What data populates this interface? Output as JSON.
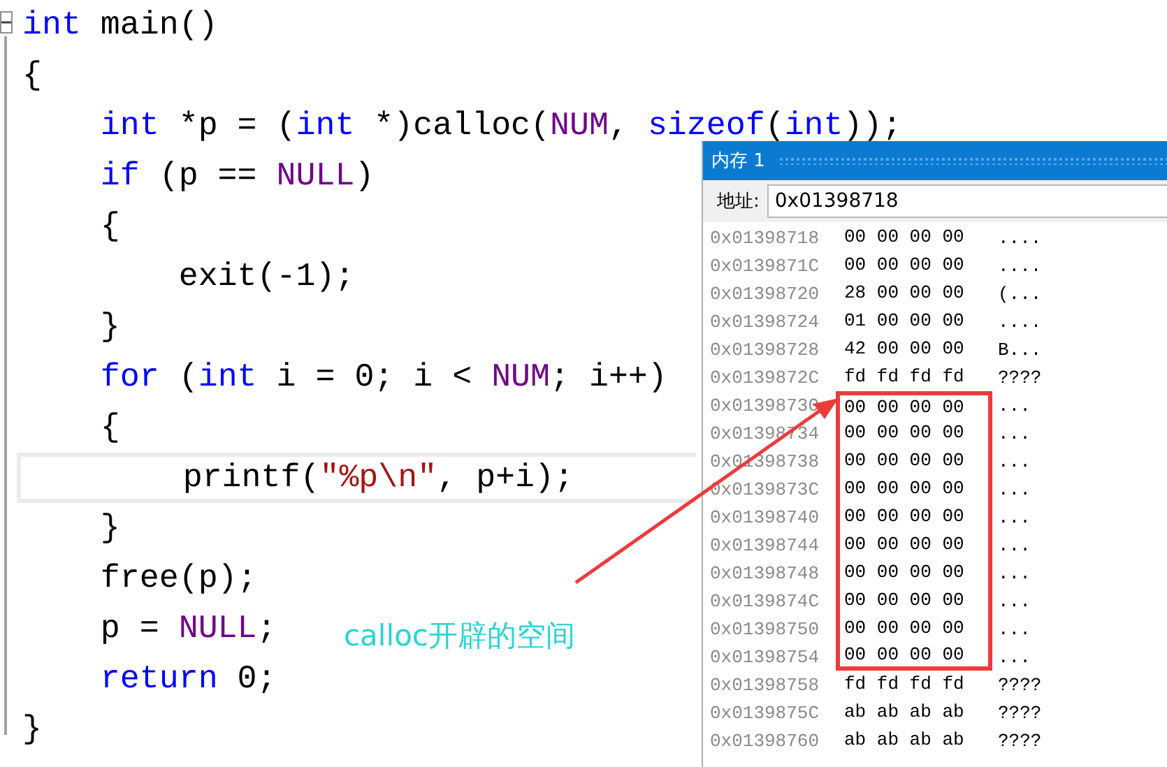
{
  "code_lines": [
    {
      "highlighted": false,
      "tokens": [
        {
          "kind": "keyword",
          "text": "int"
        },
        {
          "kind": "plain",
          "text": " main()"
        }
      ]
    },
    {
      "highlighted": false,
      "tokens": [
        {
          "kind": "plain",
          "text": "{"
        }
      ]
    },
    {
      "highlighted": false,
      "tokens": [
        {
          "kind": "keyword",
          "text": "    int"
        },
        {
          "kind": "plain",
          "text": " *p = ("
        },
        {
          "kind": "keyword",
          "text": "int"
        },
        {
          "kind": "plain",
          "text": " *)calloc("
        },
        {
          "kind": "macro",
          "text": "NUM"
        },
        {
          "kind": "plain",
          "text": ", "
        },
        {
          "kind": "keyword",
          "text": "sizeof"
        },
        {
          "kind": "plain",
          "text": "("
        },
        {
          "kind": "keyword",
          "text": "int"
        },
        {
          "kind": "plain",
          "text": "));"
        }
      ]
    },
    {
      "highlighted": false,
      "tokens": [
        {
          "kind": "keyword",
          "text": "    if"
        },
        {
          "kind": "plain",
          "text": " (p == "
        },
        {
          "kind": "macro",
          "text": "NULL"
        },
        {
          "kind": "plain",
          "text": ")"
        }
      ]
    },
    {
      "highlighted": false,
      "tokens": [
        {
          "kind": "plain",
          "text": "    {"
        }
      ]
    },
    {
      "highlighted": false,
      "tokens": [
        {
          "kind": "plain",
          "text": "        exit(-1);"
        }
      ]
    },
    {
      "highlighted": false,
      "tokens": [
        {
          "kind": "plain",
          "text": "    }"
        }
      ]
    },
    {
      "highlighted": false,
      "tokens": [
        {
          "kind": "keyword",
          "text": "    for"
        },
        {
          "kind": "plain",
          "text": " ("
        },
        {
          "kind": "keyword",
          "text": "int"
        },
        {
          "kind": "plain",
          "text": " i = 0; i < "
        },
        {
          "kind": "macro",
          "text": "NUM"
        },
        {
          "kind": "plain",
          "text": "; i++)"
        }
      ]
    },
    {
      "highlighted": false,
      "tokens": [
        {
          "kind": "plain",
          "text": "    {"
        }
      ]
    },
    {
      "highlighted": true,
      "tokens": [
        {
          "kind": "plain",
          "text": "        printf("
        },
        {
          "kind": "string",
          "text": "\"%p\\n\""
        },
        {
          "kind": "plain",
          "text": ", p+i);"
        }
      ]
    },
    {
      "highlighted": false,
      "tokens": [
        {
          "kind": "plain",
          "text": "    }"
        }
      ]
    },
    {
      "highlighted": false,
      "tokens": [
        {
          "kind": "plain",
          "text": "    free(p);"
        }
      ]
    },
    {
      "highlighted": false,
      "tokens": [
        {
          "kind": "plain",
          "text": "    p = "
        },
        {
          "kind": "macro",
          "text": "NULL"
        },
        {
          "kind": "plain",
          "text": ";"
        }
      ]
    },
    {
      "highlighted": false,
      "tokens": [
        {
          "kind": "keyword",
          "text": "    return"
        },
        {
          "kind": "plain",
          "text": " 0;"
        }
      ]
    },
    {
      "highlighted": false,
      "tokens": [
        {
          "kind": "plain",
          "text": "}"
        }
      ]
    }
  ],
  "memory_window": {
    "title": "内存 1",
    "address_label": "地址:",
    "address_value": "0x01398718",
    "rows": [
      {
        "address": "0x01398718",
        "bytes": "00 00 00 00",
        "ascii": "....",
        "boxed": false
      },
      {
        "address": "0x0139871C",
        "bytes": "00 00 00 00",
        "ascii": "....",
        "boxed": false
      },
      {
        "address": "0x01398720",
        "bytes": "28 00 00 00",
        "ascii": "(...",
        "boxed": false
      },
      {
        "address": "0x01398724",
        "bytes": "01 00 00 00",
        "ascii": "....",
        "boxed": false
      },
      {
        "address": "0x01398728",
        "bytes": "42 00 00 00",
        "ascii": "B...",
        "boxed": false
      },
      {
        "address": "0x0139872C",
        "bytes": "fd fd fd fd",
        "ascii": "????",
        "boxed": false
      },
      {
        "address": "0x01398730",
        "bytes": "00 00 00 00",
        "ascii": "...",
        "boxed": true
      },
      {
        "address": "0x01398734",
        "bytes": "00 00 00 00",
        "ascii": "...",
        "boxed": true
      },
      {
        "address": "0x01398738",
        "bytes": "00 00 00 00",
        "ascii": "...",
        "boxed": true
      },
      {
        "address": "0x0139873C",
        "bytes": "00 00 00 00",
        "ascii": "...",
        "boxed": true
      },
      {
        "address": "0x01398740",
        "bytes": "00 00 00 00",
        "ascii": "...",
        "boxed": true
      },
      {
        "address": "0x01398744",
        "bytes": "00 00 00 00",
        "ascii": "...",
        "boxed": true
      },
      {
        "address": "0x01398748",
        "bytes": "00 00 00 00",
        "ascii": "...",
        "boxed": true
      },
      {
        "address": "0x0139874C",
        "bytes": "00 00 00 00",
        "ascii": "...",
        "boxed": true
      },
      {
        "address": "0x01398750",
        "bytes": "00 00 00 00",
        "ascii": "...",
        "boxed": true
      },
      {
        "address": "0x01398754",
        "bytes": "00 00 00 00",
        "ascii": "...",
        "boxed": true
      },
      {
        "address": "0x01398758",
        "bytes": "fd fd fd fd",
        "ascii": "????",
        "boxed": false
      },
      {
        "address": "0x0139875C",
        "bytes": "ab ab ab ab",
        "ascii": "????",
        "boxed": false
      },
      {
        "address": "0x01398760",
        "bytes": "ab ab ab ab",
        "ascii": "????",
        "boxed": false
      }
    ]
  },
  "annotation": {
    "label": "calloc开辟的空间"
  }
}
